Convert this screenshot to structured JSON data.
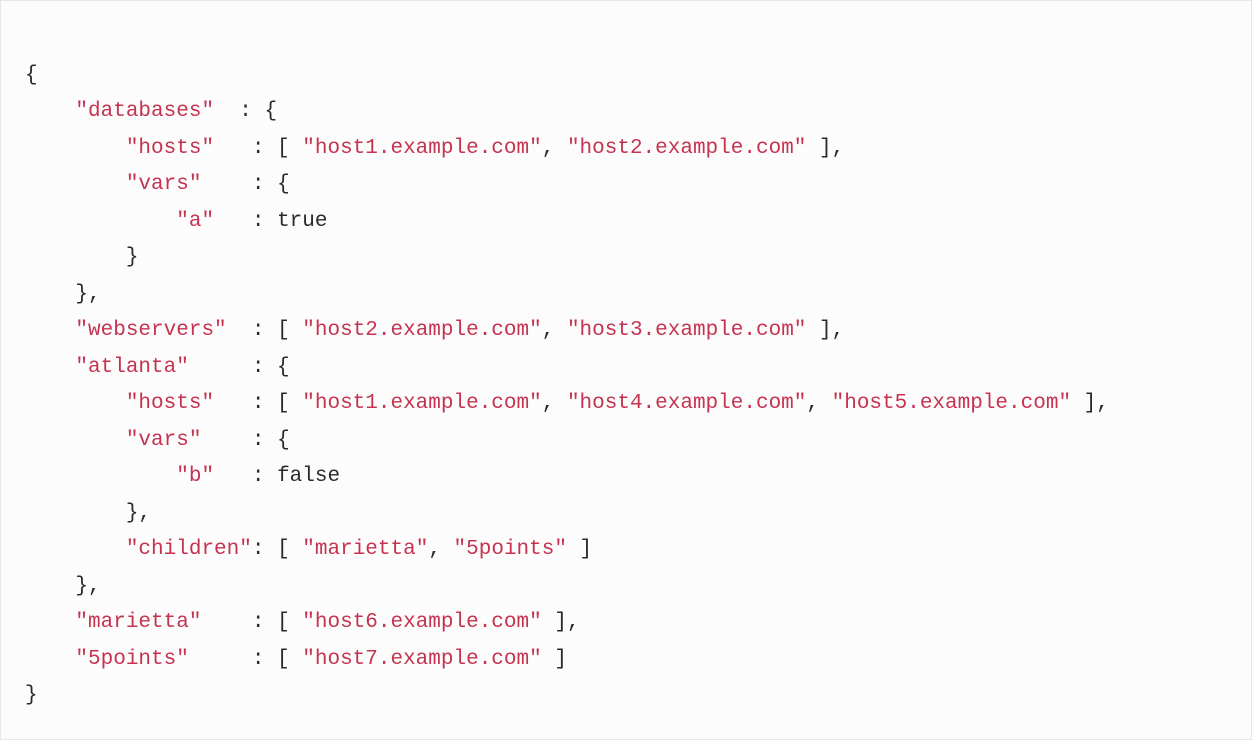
{
  "code": {
    "line1": "{",
    "line2": "    \"databases\"  : {",
    "line3": "        \"hosts\"   : [ \"host1.example.com\", \"host2.example.com\" ],",
    "line4": "        \"vars\"    : {",
    "line5": "            \"a\"   : true",
    "line6": "        }",
    "line7": "    },",
    "line8": "    \"webservers\"  : [ \"host2.example.com\", \"host3.example.com\" ],",
    "line9": "    \"atlanta\"     : {",
    "line10": "        \"hosts\"   : [ \"host1.example.com\", \"host4.example.com\", \"host5.example.com\" ],",
    "line11": "        \"vars\"    : {",
    "line12": "            \"b\"   : false",
    "line13": "        },",
    "line14": "        \"children\": [ \"marietta\", \"5points\" ]",
    "line15": "    },",
    "line16": "    \"marietta\"    : [ \"host6.example.com\" ],",
    "line17": "    \"5points\"     : [ \"host7.example.com\" ]",
    "line18": "}"
  },
  "tokens": {
    "databases": "\"databases\"",
    "hosts": "\"hosts\"",
    "vars": "\"vars\"",
    "a": "\"a\"",
    "b": "\"b\"",
    "webservers": "\"webservers\"",
    "atlanta": "\"atlanta\"",
    "children": "\"children\"",
    "marietta_key": "\"marietta\"",
    "fivepoints_key": "\"5points\"",
    "host1": "\"host1.example.com\"",
    "host2": "\"host2.example.com\"",
    "host3": "\"host3.example.com\"",
    "host4": "\"host4.example.com\"",
    "host5": "\"host5.example.com\"",
    "host6": "\"host6.example.com\"",
    "host7": "\"host7.example.com\"",
    "marietta_val": "\"marietta\"",
    "fivepoints_val": "\"5points\"",
    "true": "true",
    "false": "false"
  }
}
